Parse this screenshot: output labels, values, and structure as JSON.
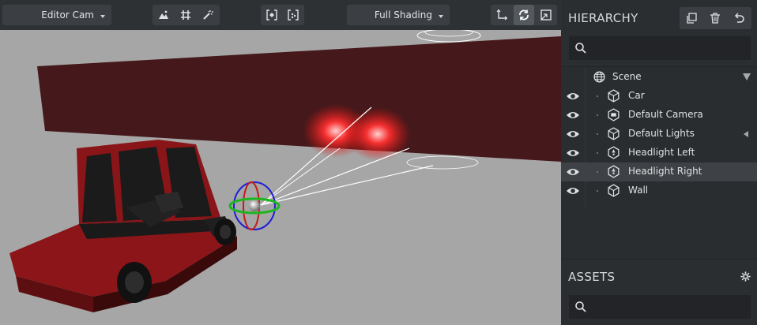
{
  "toolbar": {
    "camera_dropdown": "Editor Cam",
    "shading_dropdown": "Full Shading"
  },
  "hierarchy": {
    "title": "HIERARCHY",
    "search_placeholder": "",
    "items": [
      {
        "label": "Scene",
        "icon": "globe-icon",
        "visible": false,
        "selected": false,
        "expand": "collapse-arrow"
      },
      {
        "label": "Car",
        "icon": "entity-icon",
        "visible": true,
        "selected": false
      },
      {
        "label": "Default Camera",
        "icon": "camera-entity-icon",
        "visible": true,
        "selected": false
      },
      {
        "label": "Default Lights",
        "icon": "entity-icon",
        "visible": true,
        "selected": false,
        "expand": "expand-arrow"
      },
      {
        "label": "Headlight Left",
        "icon": "light-entity-icon",
        "visible": true,
        "selected": false
      },
      {
        "label": "Headlight Right",
        "icon": "light-entity-icon",
        "visible": true,
        "selected": true
      },
      {
        "label": "Wall",
        "icon": "entity-icon",
        "visible": true,
        "selected": false
      }
    ]
  },
  "assets": {
    "title": "ASSETS",
    "search_placeholder": ""
  },
  "colors": {
    "panel_bg": "#2b2e31",
    "viewport_bg": "#a6a6a6",
    "wall": "#45191b",
    "car": "#8a1519",
    "selected_row": "#3e4246"
  }
}
